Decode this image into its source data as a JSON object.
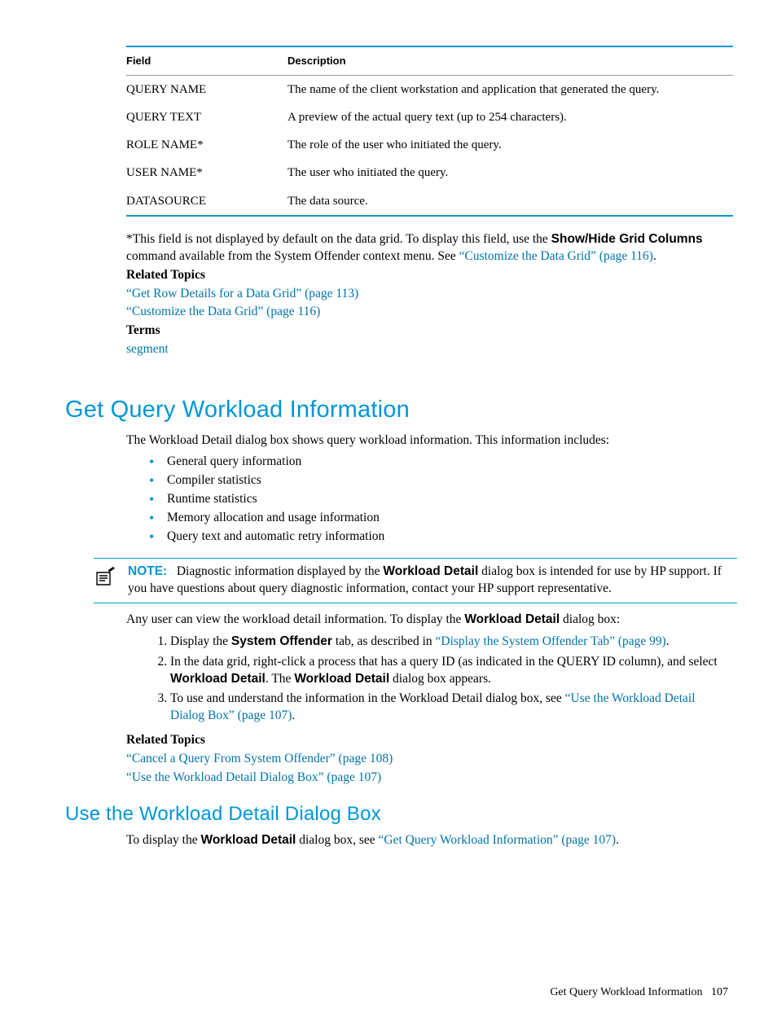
{
  "table": {
    "headers": [
      "Field",
      "Description"
    ],
    "rows": [
      {
        "field": "QUERY NAME",
        "desc": "The name of the client workstation and application that generated the query."
      },
      {
        "field": "QUERY TEXT",
        "desc": "A preview of the actual query text (up to 254 characters)."
      },
      {
        "field": "ROLE NAME*",
        "desc": "The role of the user who initiated the query."
      },
      {
        "field": "USER NAME*",
        "desc": "The user who initiated the query."
      },
      {
        "field": "DATASOURCE",
        "desc": "The data source."
      }
    ]
  },
  "footnote": {
    "pre": "*This field is not displayed by default on the data grid. To display this field, use the ",
    "bold1": "Show/Hide Grid Columns",
    "mid": " command available from the System Offender context menu. See ",
    "link": "“Customize the Data Grid” (page 116)",
    "post": "."
  },
  "related1": {
    "heading": "Related Topics",
    "link1": "“Get Row Details for a Data Grid” (page 113)",
    "link2": "“Customize the Data Grid” (page 116)",
    "termsHeading": "Terms",
    "term1": "segment"
  },
  "section1": {
    "title": "Get Query Workload Information",
    "intro": "The Workload Detail dialog box shows query workload information. This information includes:",
    "bullets": [
      "General query information",
      "Compiler statistics",
      "Runtime statistics",
      "Memory allocation and usage information",
      "Query text and automatic retry information"
    ]
  },
  "note": {
    "label": "NOTE:",
    "pre": "Diagnostic information displayed by the ",
    "bold1": "Workload Detail",
    "post": " dialog box is intended for use by HP support. If you have questions about query diagnostic information, contact your HP support representative."
  },
  "para2": {
    "pre": "Any user can view the workload detail information. To display the ",
    "bold1": "Workload Detail",
    "post": " dialog box:"
  },
  "steps": {
    "s1": {
      "pre": "Display the ",
      "bold1": "System Offender",
      "mid": " tab, as described in ",
      "link": "“Display the System Offender Tab” (page 99)",
      "post": "."
    },
    "s2": {
      "pre": "In the data grid, right-click a process that has a query ID (as indicated in the QUERY ID column), and select ",
      "bold1": "Workload Detail",
      "mid": ". The ",
      "bold2": "Workload Detail",
      "post": " dialog box appears."
    },
    "s3": {
      "pre": "To use and understand the information in the Workload Detail dialog box, see ",
      "link": "“Use the Workload Detail Dialog Box” (page 107)",
      "post": "."
    }
  },
  "related2": {
    "heading": "Related Topics",
    "link1": "“Cancel a Query From System Offender” (page 108)",
    "link2": "“Use the Workload Detail Dialog Box” (page 107)"
  },
  "section2": {
    "title": "Use the Workload Detail Dialog Box",
    "pre": "To display the ",
    "bold1": "Workload Detail",
    "mid": " dialog box, see ",
    "link": "“Get Query Workload Information” (page 107)",
    "post": "."
  },
  "footer": {
    "text": "Get Query Workload Information",
    "page": "107"
  }
}
